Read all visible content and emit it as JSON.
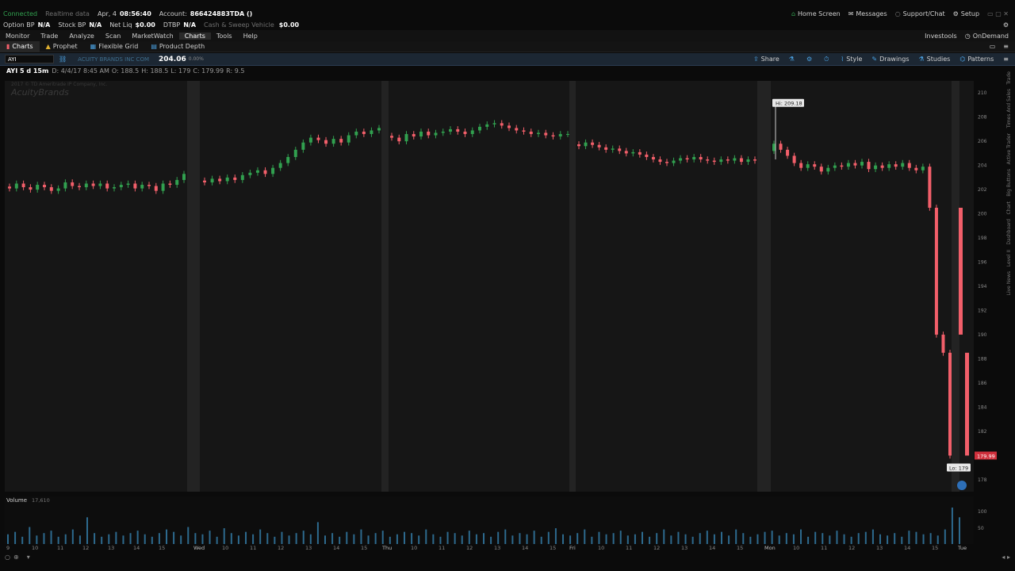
{
  "status": {
    "connection": "Connected",
    "data_mode": "Realtime data",
    "date": "Apr, 4",
    "time": "08:56:40",
    "account_label": "Account:",
    "account_value": "866424883TDA ()"
  },
  "top_right": {
    "home_screen": "Home Screen",
    "messages": "Messages",
    "support": "Support/Chat",
    "setup": "Setup"
  },
  "balances": [
    {
      "label": "Option BP",
      "value": "N/A"
    },
    {
      "label": "Stock BP",
      "value": "N/A"
    },
    {
      "label": "Net Liq",
      "value": "$0.00"
    },
    {
      "label": "DTBP",
      "value": "N/A"
    },
    {
      "label": "Cash & Sweep Vehicle",
      "value": "$0.00"
    }
  ],
  "menu": [
    "Monitor",
    "Trade",
    "Analyze",
    "Scan",
    "MarketWatch",
    "Charts",
    "Tools",
    "Help"
  ],
  "menu_active": "Charts",
  "menu_right": {
    "investools": "Investools",
    "ondemand": "OnDemand"
  },
  "chart_tabs": [
    "Charts",
    "Prophet",
    "Flexible Grid",
    "Product Depth"
  ],
  "symbol_bar": {
    "symbol": "AYI",
    "company": "ACUITY BRANDS INC COM",
    "price": "204.06",
    "change": "0.00%",
    "tools": [
      "Share",
      "Style",
      "Drawings",
      "Studies",
      "Patterns"
    ]
  },
  "info": {
    "label": "AYI 5 d 15m",
    "datetime": "D: 4/4/17 8:45 AM",
    "open": "O: 188.5",
    "high": "H: 188.5",
    "low": "L: 179",
    "close": "C: 179.99",
    "range": "R: 9.5"
  },
  "watermark": {
    "copyright": "2017 © TD Ameritrade IP Company, Inc.",
    "logo": "AcuityBrands"
  },
  "volume_label": "Volume",
  "volume_value": "17,610",
  "side_tabs": [
    "Trade",
    "Times And Sales",
    "Active Trader",
    "Big Buttons",
    "Chart",
    "Dashboard",
    "Level II",
    "Live News"
  ],
  "colors": {
    "up": "#31a04f",
    "down": "#f25f6a",
    "volume": "#2d6a8e",
    "accent": "#4aa0e0",
    "background": "#0b0b0b",
    "separator": "#303030"
  },
  "chart_data": {
    "type": "candlestick",
    "title": "AYI 5 d 15m",
    "y_axis_ticks": [
      "178",
      "180",
      "182",
      "184",
      "186",
      "188",
      "190",
      "192",
      "194",
      "196",
      "198",
      "200",
      "202",
      "204",
      "206",
      "208",
      "210"
    ],
    "ylim": [
      177,
      211
    ],
    "volume_axis_ticks": [
      "100",
      "50"
    ],
    "volume_axis_unit": "thousands",
    "hi_label": "Hi: 209.18",
    "lo_label": "Lo: 179",
    "last_price_label": "179.99",
    "day_labels": [
      "Wed",
      "Thu",
      "Fri",
      "Mon",
      "Tue"
    ],
    "hour_labels": {
      "first": [
        "9",
        "10",
        "11",
        "12",
        "13",
        "14",
        "15"
      ],
      "day": [
        "10",
        "11",
        "12",
        "13",
        "14",
        "15"
      ]
    },
    "series": [
      {
        "closes": [
          202.1,
          202.5,
          202.2,
          202.0,
          202.4,
          202.2,
          201.9,
          202.1,
          202.6,
          202.3,
          202.2,
          202.5,
          202.3,
          202.5,
          202.1,
          202.2,
          202.4,
          202.5,
          202.1,
          202.4,
          202.3,
          201.9,
          202.5,
          202.4,
          202.8,
          203.3
        ]
      },
      {
        "closes": [
          202.6,
          202.9,
          202.7,
          203.0,
          202.8,
          203.2,
          203.4,
          203.6,
          203.3,
          203.8,
          204.2,
          204.7,
          205.3,
          205.9,
          206.3,
          206.1,
          205.8,
          206.2,
          205.9,
          206.5,
          206.8,
          206.6,
          206.9,
          207.1
        ]
      },
      {
        "closes": [
          206.3,
          206.0,
          206.6,
          206.4,
          206.8,
          206.5,
          206.7,
          206.8,
          207.0,
          206.8,
          206.6,
          206.9,
          207.2,
          207.4,
          207.5,
          207.3,
          207.1,
          206.9,
          206.8,
          206.6,
          206.7,
          206.5,
          206.4,
          206.6,
          206.6
        ]
      },
      {
        "closes": [
          205.6,
          205.9,
          205.7,
          205.5,
          205.3,
          205.4,
          205.2,
          205.0,
          205.1,
          204.9,
          204.7,
          204.5,
          204.3,
          204.2,
          204.4,
          204.6,
          204.5,
          204.7,
          204.5,
          204.4,
          204.3,
          204.5,
          204.4,
          204.6,
          204.3,
          204.5,
          204.4
        ]
      },
      {
        "closes": [
          205.8,
          205.3,
          204.8,
          204.2,
          203.8,
          204.1,
          203.9,
          203.5,
          203.8,
          204.0,
          203.9,
          204.2,
          204.0,
          204.3,
          203.7,
          204.0,
          203.8,
          204.1,
          203.9,
          204.2,
          203.8,
          203.6,
          203.9,
          200.5,
          190.0,
          188.5,
          179.99
        ]
      }
    ],
    "volume": [
      8,
      10,
      6,
      14,
      7,
      9,
      11,
      6,
      8,
      12,
      7,
      22,
      9,
      6,
      8,
      10,
      7,
      9,
      11,
      8,
      6,
      9,
      12,
      10,
      7,
      14,
      9,
      8,
      11,
      6,
      13,
      9,
      7,
      10,
      8,
      12,
      9,
      6,
      10,
      7,
      9,
      11,
      8,
      18,
      7,
      9,
      6,
      10,
      8,
      12,
      7,
      9,
      11,
      6,
      8,
      10,
      9,
      7,
      12,
      8,
      6,
      10,
      9,
      7,
      11,
      8,
      9,
      6,
      10,
      12,
      7,
      9,
      8,
      11,
      6,
      10,
      13,
      8,
      7,
      9,
      12,
      6,
      10,
      8,
      9,
      11,
      7,
      8,
      10,
      6,
      9,
      12,
      7,
      10,
      8,
      6,
      9,
      11,
      8,
      10,
      7,
      12,
      9,
      6,
      8,
      10,
      11,
      7,
      9,
      8,
      12,
      6,
      10,
      9,
      7,
      11,
      8,
      6,
      9,
      10,
      12,
      8,
      7,
      9,
      6,
      11,
      10,
      8,
      9,
      7,
      12,
      30,
      22
    ]
  },
  "bottom_controls": [
    "zoom-out",
    "zoom-in",
    "scroll-down"
  ]
}
